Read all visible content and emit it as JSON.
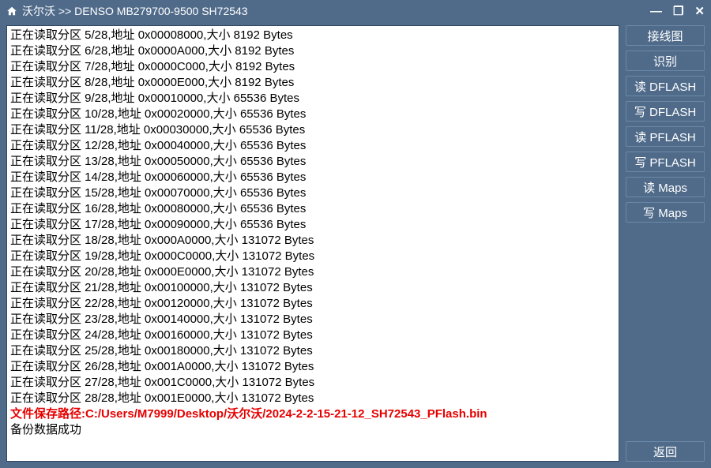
{
  "titlebar": {
    "breadcrumb": "沃尔沃 >> DENSO MB279700-9500 SH72543"
  },
  "log": {
    "prefix": "正在读取分区",
    "addr_label": "地址",
    "size_label": "大小",
    "size_unit": "Bytes",
    "total": 28,
    "entries": [
      {
        "idx": 5,
        "addr": "0x00008000",
        "size": 8192
      },
      {
        "idx": 6,
        "addr": "0x0000A000",
        "size": 8192
      },
      {
        "idx": 7,
        "addr": "0x0000C000",
        "size": 8192
      },
      {
        "idx": 8,
        "addr": "0x0000E000",
        "size": 8192
      },
      {
        "idx": 9,
        "addr": "0x00010000",
        "size": 65536
      },
      {
        "idx": 10,
        "addr": "0x00020000",
        "size": 65536
      },
      {
        "idx": 11,
        "addr": "0x00030000",
        "size": 65536
      },
      {
        "idx": 12,
        "addr": "0x00040000",
        "size": 65536
      },
      {
        "idx": 13,
        "addr": "0x00050000",
        "size": 65536
      },
      {
        "idx": 14,
        "addr": "0x00060000",
        "size": 65536
      },
      {
        "idx": 15,
        "addr": "0x00070000",
        "size": 65536
      },
      {
        "idx": 16,
        "addr": "0x00080000",
        "size": 65536
      },
      {
        "idx": 17,
        "addr": "0x00090000",
        "size": 65536
      },
      {
        "idx": 18,
        "addr": "0x000A0000",
        "size": 131072
      },
      {
        "idx": 19,
        "addr": "0x000C0000",
        "size": 131072
      },
      {
        "idx": 20,
        "addr": "0x000E0000",
        "size": 131072
      },
      {
        "idx": 21,
        "addr": "0x00100000",
        "size": 131072
      },
      {
        "idx": 22,
        "addr": "0x00120000",
        "size": 131072
      },
      {
        "idx": 23,
        "addr": "0x00140000",
        "size": 131072
      },
      {
        "idx": 24,
        "addr": "0x00160000",
        "size": 131072
      },
      {
        "idx": 25,
        "addr": "0x00180000",
        "size": 131072
      },
      {
        "idx": 26,
        "addr": "0x001A0000",
        "size": 131072
      },
      {
        "idx": 27,
        "addr": "0x001C0000",
        "size": 131072
      },
      {
        "idx": 28,
        "addr": "0x001E0000",
        "size": 131072
      }
    ],
    "save_path_label": "文件保存路径:",
    "save_path": "C:/Users/M7999/Desktop/沃尔沃/2024-2-2-15-21-12_SH72543_PFlash.bin",
    "success_msg": "备份数据成功"
  },
  "sidebar": {
    "buttons": [
      {
        "name": "wiring-diagram-button",
        "label": "接线图"
      },
      {
        "name": "identify-button",
        "label": "识别"
      },
      {
        "name": "read-dflash-button",
        "label": "读 DFLASH"
      },
      {
        "name": "write-dflash-button",
        "label": "写 DFLASH"
      },
      {
        "name": "read-pflash-button",
        "label": "读 PFLASH"
      },
      {
        "name": "write-pflash-button",
        "label": "写 PFLASH"
      },
      {
        "name": "read-maps-button",
        "label": "读 Maps"
      },
      {
        "name": "write-maps-button",
        "label": "写 Maps"
      }
    ],
    "back_label": "返回"
  }
}
